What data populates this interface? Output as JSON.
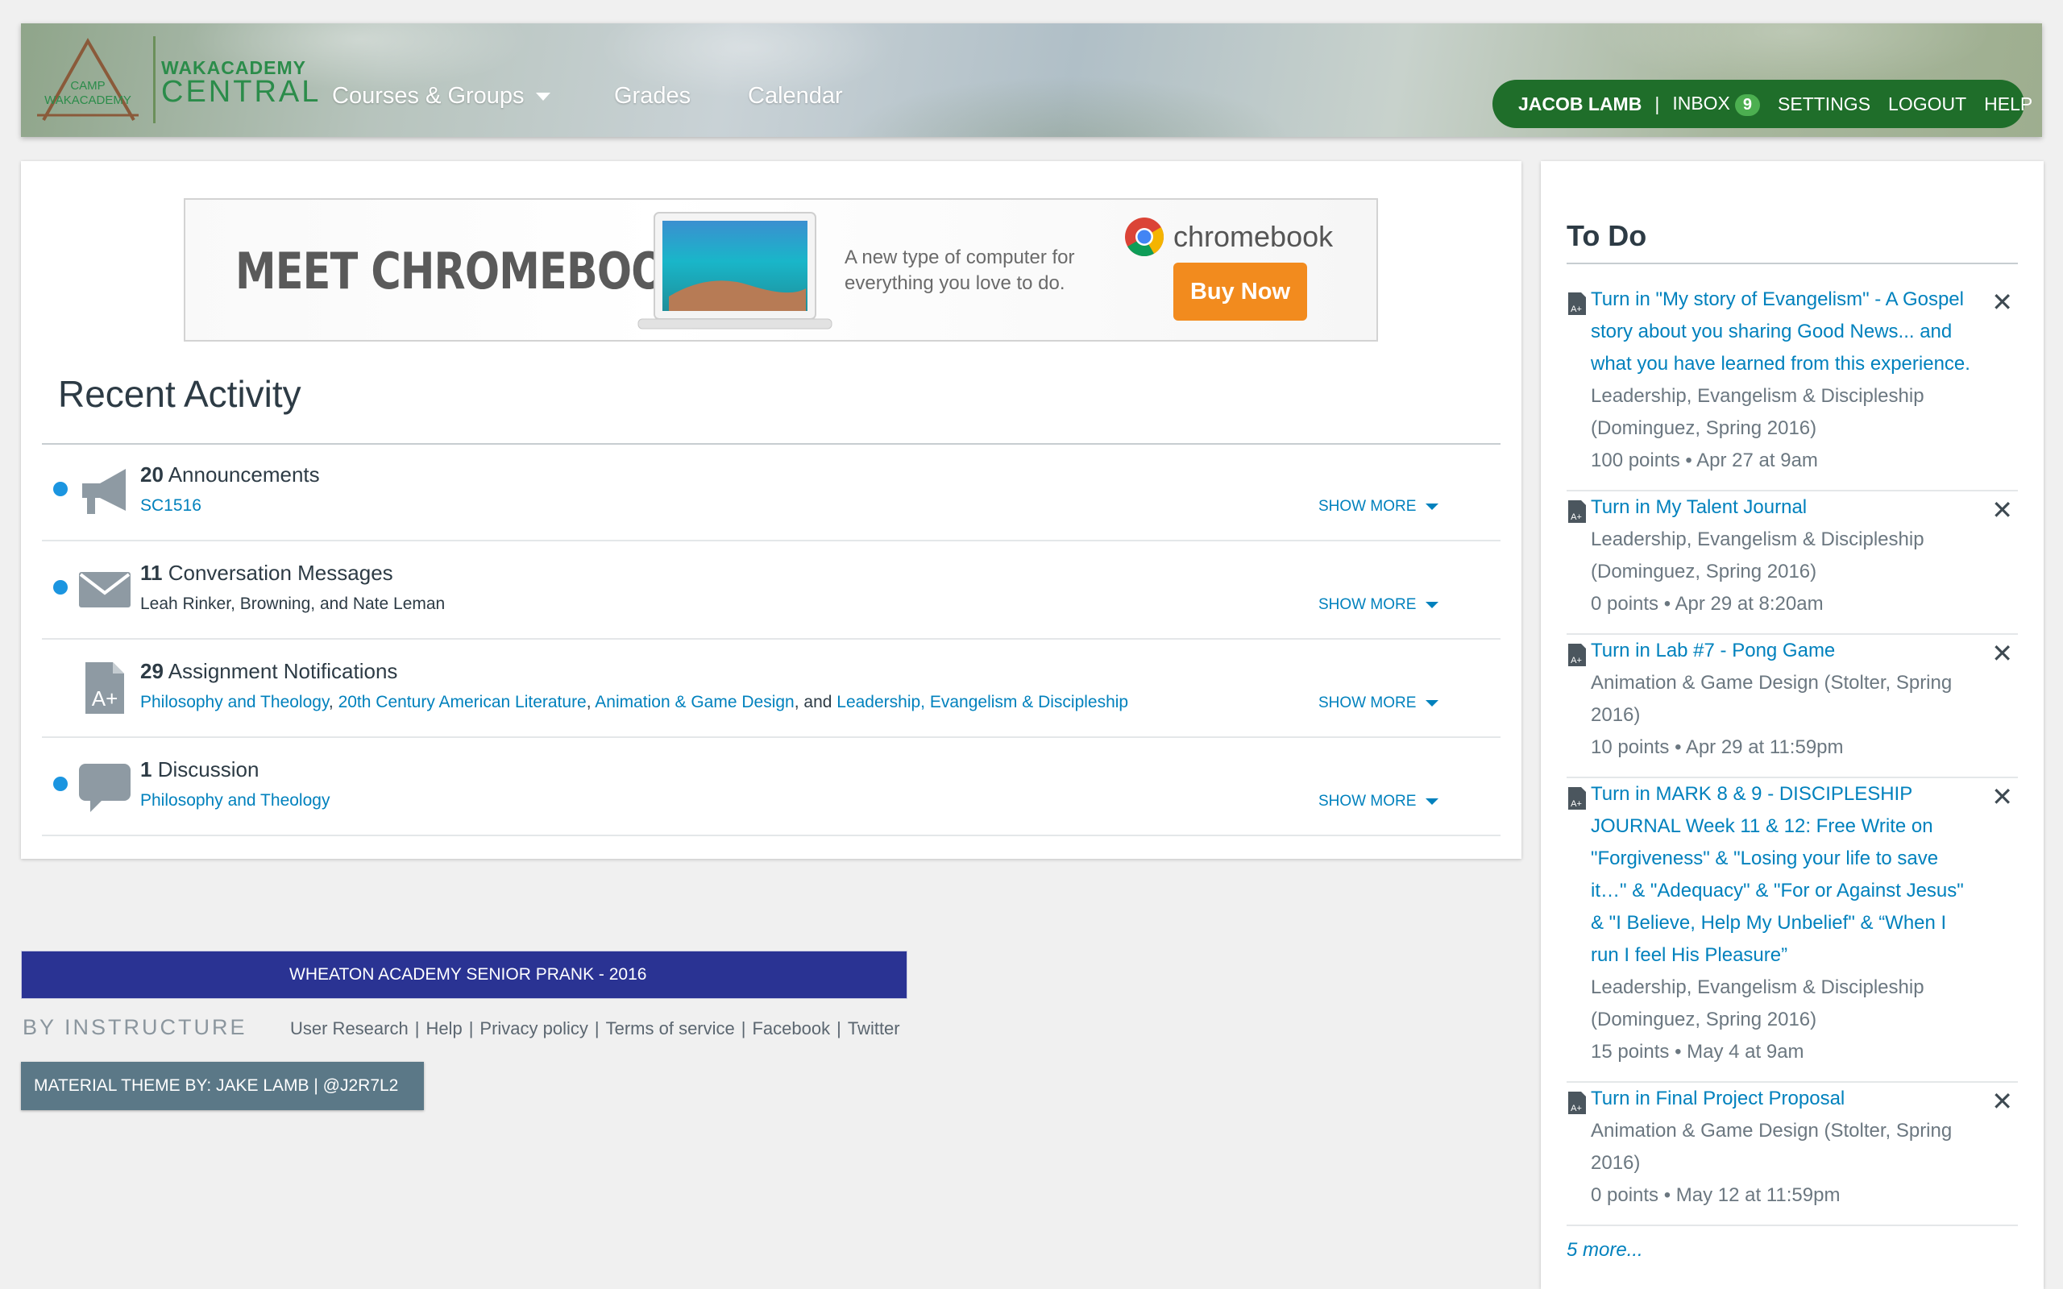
{
  "header": {
    "logo_badge": "CAMP WAKACADEMY",
    "logo_title": "WAKACADEMY",
    "logo_subtitle": "CENTRAL",
    "nav": [
      {
        "label": "Courses & Groups"
      },
      {
        "label": "Grades"
      },
      {
        "label": "Calendar"
      }
    ],
    "user": {
      "name": "JACOB LAMB",
      "separator": "|",
      "inbox_label": "INBOX",
      "inbox_count": "9",
      "settings": "SETTINGS",
      "logout": "LOGOUT",
      "help": "HELP"
    },
    "accent_color": "#1f6e2a"
  },
  "ad": {
    "headline": "MEET CHROMEBOOK",
    "tagline": "A new type of computer for everything you love to do.",
    "brand": "chromebook",
    "cta": "Buy Now"
  },
  "recent_activity": {
    "title": "Recent Activity",
    "show_more": "SHOW MORE",
    "items": [
      {
        "count": "20",
        "label": "Announcements",
        "icon": "megaphone-icon",
        "unread": true,
        "sub": [
          {
            "text": "SC1516",
            "link": true
          }
        ]
      },
      {
        "count": "11",
        "label": "Conversation Messages",
        "icon": "envelope-icon",
        "unread": true,
        "sub": [
          {
            "text": "Leah Rinker, Browning, and Nate Leman",
            "link": false
          }
        ]
      },
      {
        "count": "29",
        "label": "Assignment Notifications",
        "icon": "assignment-icon",
        "unread": false,
        "sub": [
          {
            "text": "Philosophy and Theology",
            "link": true
          },
          {
            "text": ", ",
            "link": false
          },
          {
            "text": "20th Century American Literature",
            "link": true
          },
          {
            "text": ", ",
            "link": false
          },
          {
            "text": "Animation & Game Design",
            "link": true
          },
          {
            "text": ", and ",
            "link": false
          },
          {
            "text": "Leadership, Evangelism & Discipleship",
            "link": true
          }
        ]
      },
      {
        "count": "1",
        "label": "Discussion",
        "icon": "discussion-icon",
        "unread": true,
        "sub": [
          {
            "text": "Philosophy and Theology",
            "link": true
          }
        ]
      }
    ]
  },
  "footer": {
    "banner": "WHEATON ACADEMY SENIOR PRANK - 2016",
    "by_instructure": "BY INSTRUCTURE",
    "links": [
      "User Research",
      "Help",
      "Privacy policy",
      "Terms of service",
      "Facebook",
      "Twitter"
    ],
    "theme_credit": "MATERIAL THEME BY: JAKE LAMB | @J2R7L2"
  },
  "todo": {
    "title": "To Do",
    "items": [
      {
        "title": "Turn in \"My story of Evangelism\" - A Gospel story about you sharing Good News... and what you have learned from this experience.",
        "context": "Leadership, Evangelism & Discipleship (Dominguez, Spring 2016)",
        "meta": "100 points • Apr 27 at 9am"
      },
      {
        "title": "Turn in My Talent Journal",
        "context": "Leadership, Evangelism & Discipleship (Dominguez, Spring 2016)",
        "meta": "0 points • Apr 29 at 8:20am"
      },
      {
        "title": "Turn in Lab #7 - Pong Game",
        "context": "Animation & Game Design (Stolter, Spring 2016)",
        "meta": "10 points • Apr 29 at 11:59pm"
      },
      {
        "title": "Turn in MARK 8 & 9 - DISCIPLESHIP JOURNAL Week 11 & 12: Free Write on \"Forgiveness\" & \"Losing your life to save it…\" & \"Adequacy\" & \"For or Against Jesus\" & \"I Believe, Help My Unbelief\" & “When I run I feel His Pleasure”",
        "context": "Leadership, Evangelism & Discipleship (Dominguez, Spring 2016)",
        "meta": "15 points • May 4 at 9am"
      },
      {
        "title": "Turn in Final Project Proposal",
        "context": "Animation & Game Design (Stolter, Spring 2016)",
        "meta": "0 points • May 12 at 11:59pm"
      }
    ],
    "more": "5 more...",
    "dismiss_glyph": "✕"
  }
}
